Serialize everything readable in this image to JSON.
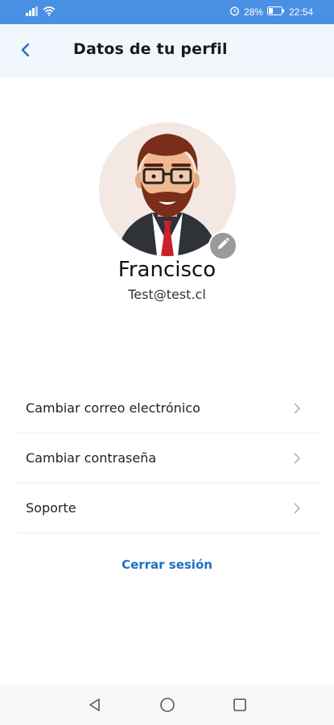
{
  "status_bar": {
    "battery": "28%",
    "time": "22:54",
    "icons": [
      "signal-icon",
      "wifi-icon",
      "alarm-icon",
      "battery-icon"
    ]
  },
  "header": {
    "title": "Datos de tu perfil",
    "back_icon": "chevron-left-icon"
  },
  "profile": {
    "name": "Francisco",
    "email": "Test@test.cl",
    "avatar_icon": "avatar-illustration",
    "edit_icon": "pencil-icon"
  },
  "menu": {
    "items": [
      {
        "label": "Cambiar correo electrónico"
      },
      {
        "label": "Cambiar contraseña"
      },
      {
        "label": "Soporte"
      }
    ]
  },
  "logout_label": "Cerrar sesión",
  "nav": {
    "icons": [
      "back-triangle-icon",
      "home-circle-icon",
      "recents-square-icon"
    ]
  },
  "colors": {
    "accent": "#1e6fc6",
    "status_bar": "#4a90e2",
    "header_bg": "#f2f7fd"
  }
}
